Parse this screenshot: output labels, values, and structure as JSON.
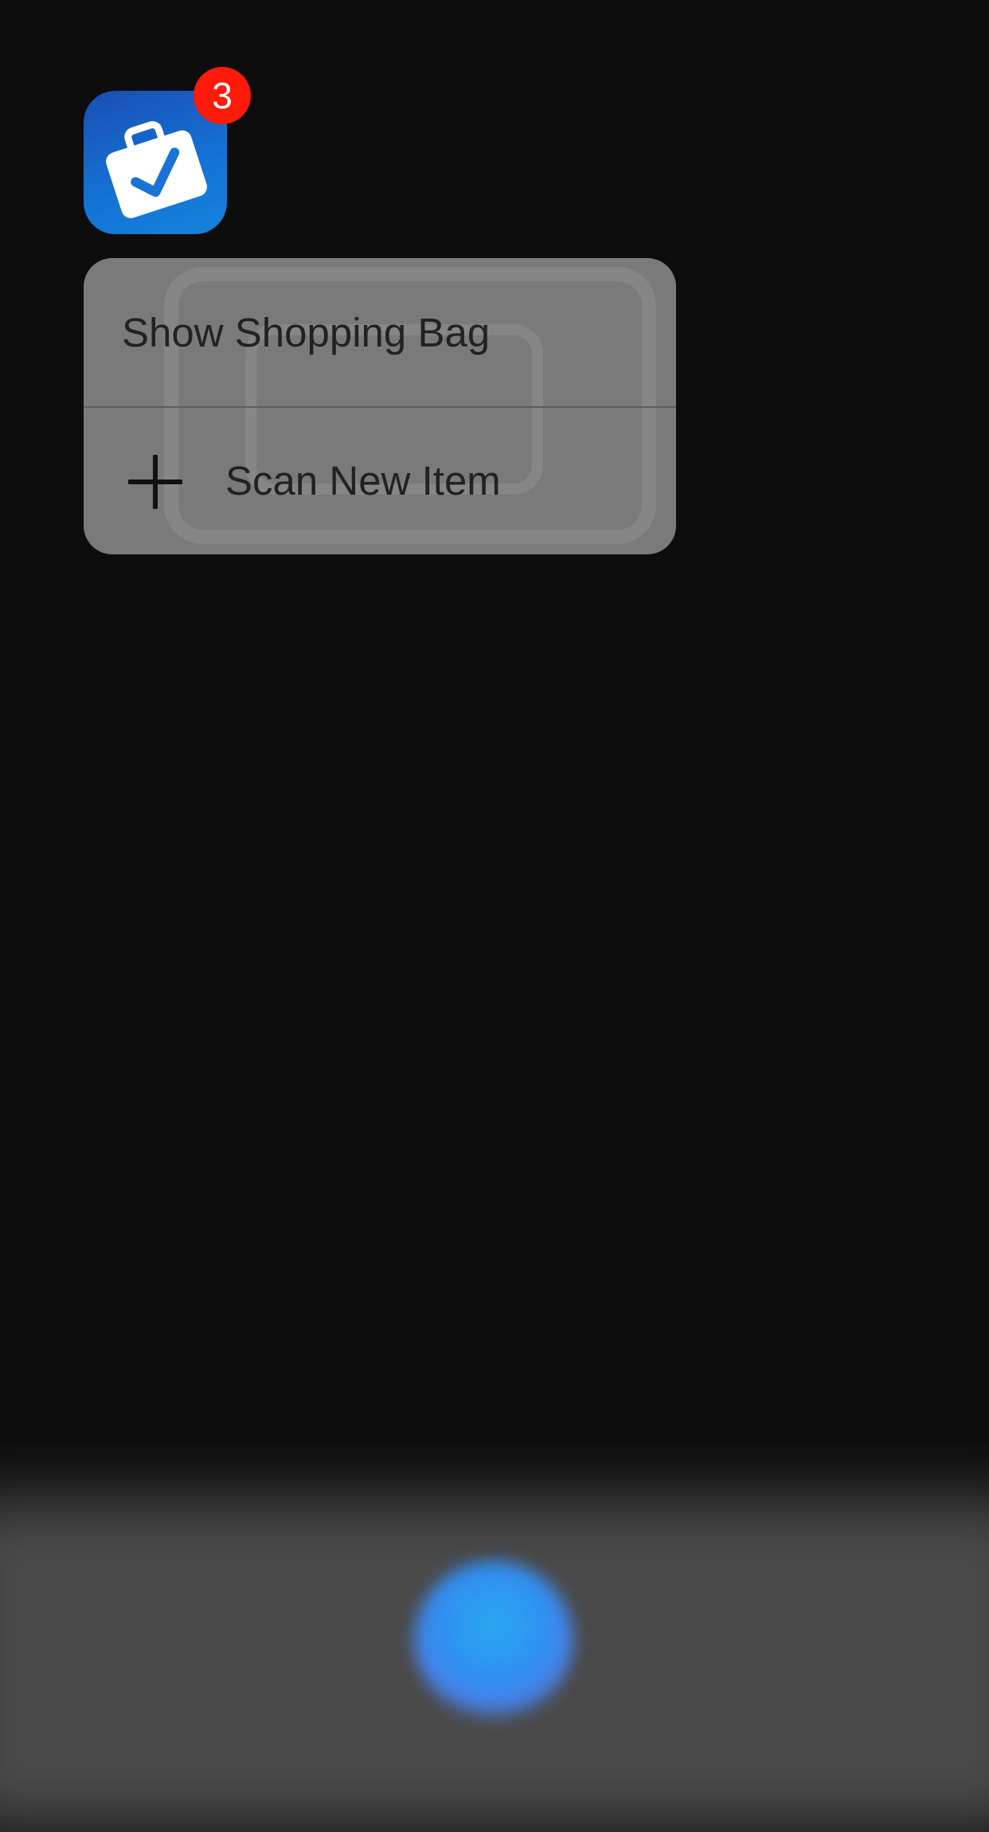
{
  "app": {
    "icon_name": "briefcase-check-icon",
    "badge_count": "3",
    "colors": {
      "icon_gradient_top": "#1a4fb3",
      "icon_gradient_bottom": "#1582dc",
      "badge": "#ff1a0a"
    }
  },
  "quick_actions": {
    "items": [
      {
        "label": "Show Shopping Bag",
        "icon": ""
      },
      {
        "label": "Scan New Item",
        "icon": "plus-icon"
      }
    ]
  },
  "background": {
    "color": "#0d0d0d",
    "dock_color": "#4a4a4a",
    "siri_orb_color": "#2f8ff0"
  }
}
